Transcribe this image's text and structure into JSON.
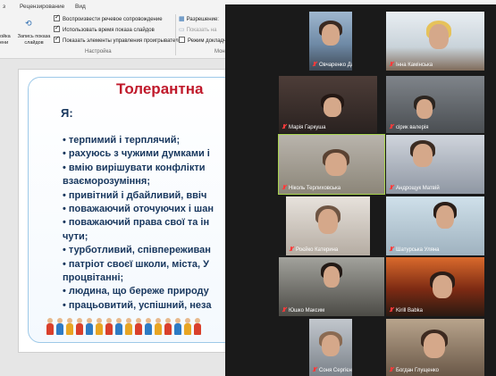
{
  "ribbon": {
    "tabs": [
      "з",
      "Рецензирование",
      "Вид"
    ],
    "buttons": [
      {
        "label": "ойка\nени"
      },
      {
        "label": "Запись показа\nслайдов"
      }
    ],
    "checks": [
      {
        "label": "Воспроизвести речевое сопровождение",
        "checked": true
      },
      {
        "label": "Использовать время показа слайдов",
        "checked": true
      },
      {
        "label": "Показать элементы управления проигрывателем",
        "checked": true
      }
    ],
    "group_label": "Настройка",
    "monitor": {
      "resolution_label": "Разрешение: ",
      "show_on_label": "Показать на",
      "presenter_label": "Режим докладч"
    },
    "monitor_group_label": "Мони"
  },
  "slide": {
    "title": "Толерантна",
    "subtitle": "Я:",
    "items": [
      "• терпимий і терплячий;",
      "• рахуюсь з чужими думками і",
      "• вмію вирішувати конфлікти",
      "     взаєморозуміння;",
      "• привітний і дбайливий, ввіч",
      "• поважаючий оточуючих і шан",
      "• поважаючий права свої та ін",
      "     чути;",
      "• турботливий, співпереживан",
      "• патріот своєї школи, міста, У",
      "     процвітанні;",
      "• людина, що береже природу",
      "• працьовитий, успішний, неза"
    ]
  },
  "participants": [
    {
      "name": "Овчаренко Даніїл"
    },
    {
      "name": "Інна Камінська"
    },
    {
      "name": "Марія Гаркуша"
    },
    {
      "name": "сірик валерія"
    },
    {
      "name": "Ніколь Терлиховська"
    },
    {
      "name": "Андрощук Матвій"
    },
    {
      "name": "Роєйко Катерина"
    },
    {
      "name": "Шатурська Уляна"
    },
    {
      "name": "Юшко Максим"
    },
    {
      "name": "Kirill Babka"
    },
    {
      "name": "Соня Сергієнко"
    },
    {
      "name": "Богдан Глущенко"
    }
  ]
}
